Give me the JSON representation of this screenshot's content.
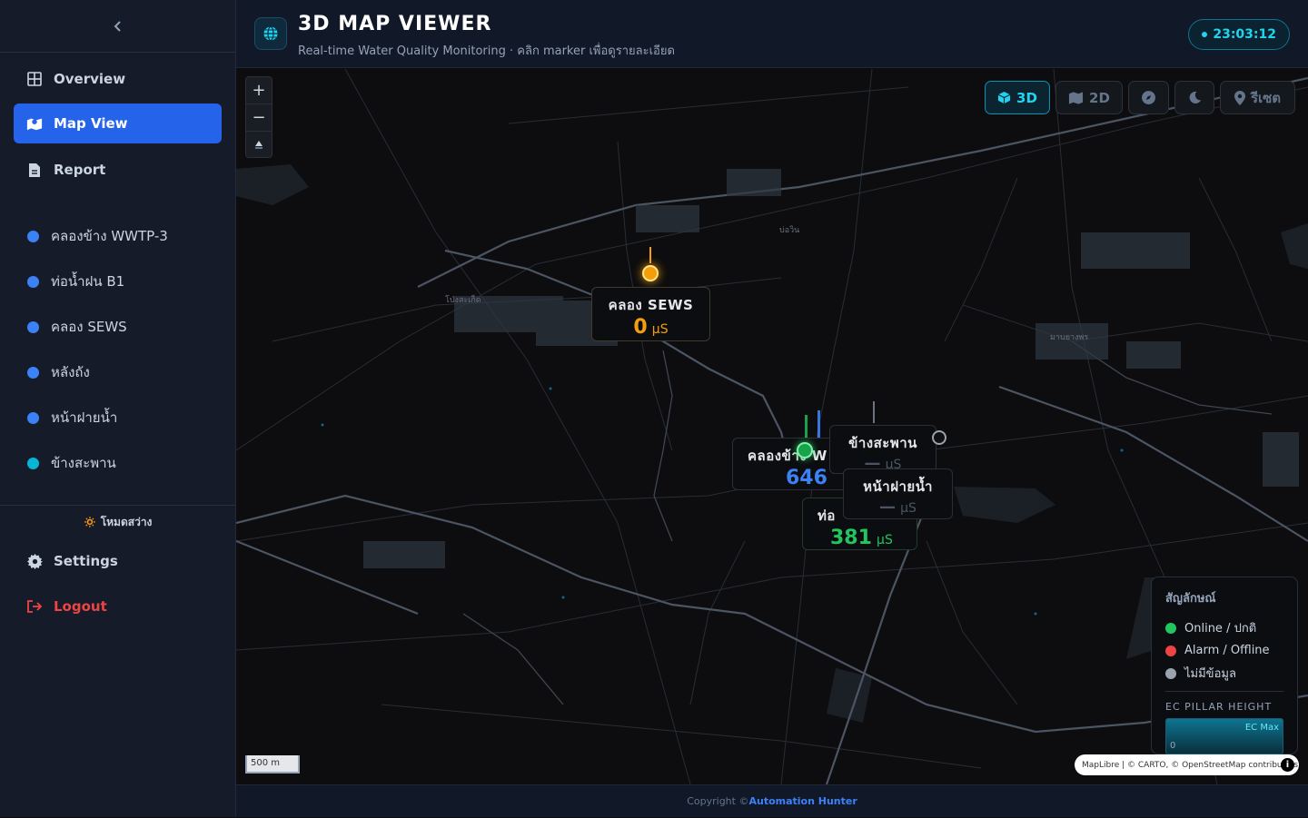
{
  "sidebar": {
    "collapse_icon": "chevron-left-icon",
    "nav": [
      {
        "label": "Overview",
        "icon": "grid-icon"
      },
      {
        "label": "Map View",
        "icon": "map-icon"
      },
      {
        "label": "Report",
        "icon": "document-icon"
      }
    ],
    "stations": [
      {
        "label": "คลองข้าง WWTP-3",
        "color": "#3b82f6"
      },
      {
        "label": "ท่อน้ำฝน B1",
        "color": "#3b82f6"
      },
      {
        "label": "คลอง SEWS",
        "color": "#3b82f6"
      },
      {
        "label": "หลังถัง",
        "color": "#3b82f6"
      },
      {
        "label": "หน้าฝายน้ำ",
        "color": "#3b82f6"
      },
      {
        "label": "ข้างสะพาน",
        "color": "#06b6d4"
      }
    ],
    "light_mode": "🔅 โหมดสว่าง",
    "settings": "Settings",
    "logout": "Logout"
  },
  "header": {
    "title": "3D MAP VIEWER",
    "subtitle": "Real-time Water Quality Monitoring · คลิก marker เพื่อดูรายละเอียด",
    "clock": "23:03:12"
  },
  "toolbar": {
    "btn_3d": "3D",
    "btn_2d": "2D",
    "btn_reset": "รีเซต"
  },
  "markers": {
    "sews": {
      "name": "คลอง SEWS",
      "value": "0",
      "unit": "µS",
      "color": "#f59e0b"
    },
    "wwtp": {
      "name": "คลองข้าง W",
      "value": "646",
      "unit": "µS",
      "color": "#3b82f6"
    },
    "b1": {
      "name": "ท่อ",
      "value": "381",
      "unit": "µS",
      "color": "#22c55e"
    },
    "bridge": {
      "name": "ข้างสะพาน",
      "value": "—",
      "unit": "µS"
    },
    "weir": {
      "name": "หน้าฝายน้ำ",
      "value": "—",
      "unit": "µS"
    }
  },
  "map_labels": [
    "บ่อวิน",
    "โป่งสะเก็ด",
    "มาบยางพร"
  ],
  "legend": {
    "title": "สัญลักษณ์",
    "items": [
      {
        "label": "Online / ปกติ",
        "color": "#22c55e"
      },
      {
        "label": "Alarm / Offline",
        "color": "#ef4444"
      },
      {
        "label": "ไม่มีข้อมูล",
        "color": "#9ca3af"
      }
    ],
    "ec_title": "EC PILLAR HEIGHT",
    "ec_max": "EC Max",
    "ec_min": "0"
  },
  "scale": "500 m",
  "attribution": "MapLibre | © CARTO, © OpenStreetMap contributors",
  "footer": {
    "prefix": "Copyright ©",
    "brand": "Automation Hunter"
  }
}
